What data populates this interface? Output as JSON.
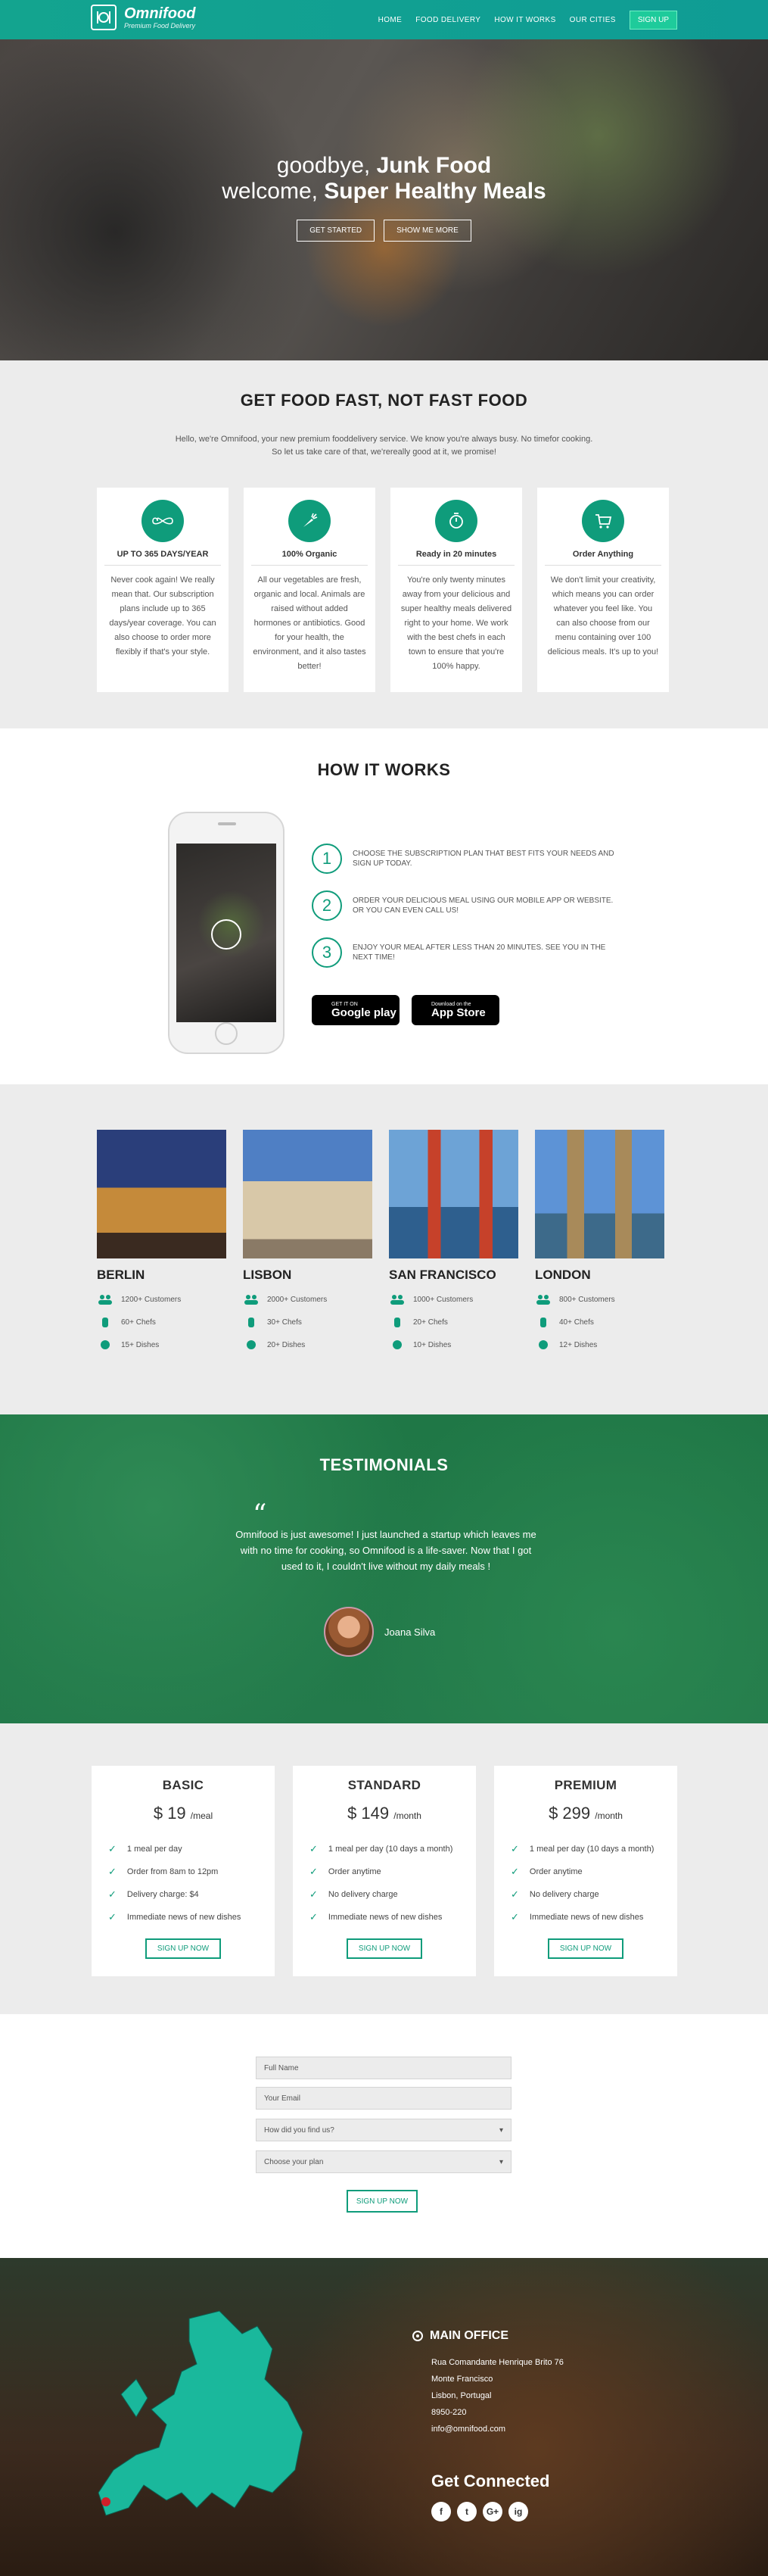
{
  "nav": {
    "brand": "Omnifood",
    "tagline": "Premium Food Delivery",
    "links": [
      "HOME",
      "FOOD DELIVERY",
      "HOW IT WORKS",
      "OUR CITIES"
    ],
    "cta": "SIGN UP"
  },
  "hero": {
    "line1_light": "goodbye, ",
    "line1_bold": "Junk Food",
    "line2_light": "welcome, ",
    "line2_bold": "Super Healthy Meals",
    "btn_primary": "GET STARTED",
    "btn_secondary": "SHOW ME MORE"
  },
  "features": {
    "title": "GET FOOD FAST, NOT FAST FOOD",
    "intro": "Hello, we're Omnifood, your new premium fooddelivery service. We know you're always busy. No timefor cooking. So let us take care of that, we'rereally good at it, we promise!",
    "cards": [
      {
        "icon": "infinity-icon",
        "title": "UP TO 365 DAYS/YEAR",
        "text": "Never cook again! We really mean that. Our subscription plans include up to 365 days/year coverage. You can also choose to order more flexibly if that's your style."
      },
      {
        "icon": "carrot-icon",
        "title": "100% Organic",
        "text": "All our vegetables are fresh, organic and local. Animals are raised without added hormones or antibiotics. Good for your health, the environment, and it also tastes better!"
      },
      {
        "icon": "stopwatch-icon",
        "title": "Ready in 20 minutes",
        "text": "You're only twenty minutes away from your delicious and super healthy meals delivered right to your home. We work with the best chefs in each town to ensure that you're 100% happy."
      },
      {
        "icon": "cart-icon",
        "title": "Order Anything",
        "text": "We don't limit your creativity, which means you can order whatever you feel like. You can also choose from our menu containing over 100 delicious meals. It's up to you!"
      }
    ]
  },
  "how": {
    "title": "HOW IT WORKS",
    "steps": [
      {
        "num": "1",
        "text": "CHOOSE THE SUBSCRIPTION PLAN THAT BEST FITS YOUR NEEDS AND SIGN UP TODAY."
      },
      {
        "num": "2",
        "text": "ORDER YOUR DELICIOUS MEAL USING OUR MOBILE APP OR WEBSITE. OR YOU CAN EVEN CALL US!"
      },
      {
        "num": "3",
        "text": "ENJOY YOUR MEAL AFTER LESS THAN 20 MINUTES. SEE YOU IN THE NEXT TIME!"
      }
    ],
    "google_small": "GET IT ON",
    "google_big": "Google play",
    "apple_small": "Download on the",
    "apple_big": "App Store"
  },
  "cities": [
    {
      "name": "BERLIN",
      "customers": "1200+ Customers",
      "chefs": "60+ Chefs",
      "dishes": "15+ Dishes"
    },
    {
      "name": "LISBON",
      "customers": "2000+ Customers",
      "chefs": "30+ Chefs",
      "dishes": "20+ Dishes"
    },
    {
      "name": "SAN FRANCISCO",
      "customers": "1000+ Customers",
      "chefs": "20+ Chefs",
      "dishes": "10+ Dishes"
    },
    {
      "name": "LONDON",
      "customers": "800+ Customers",
      "chefs": "40+ Chefs",
      "dishes": "12+ Dishes"
    }
  ],
  "testimonials": {
    "title": "TESTIMONIALS",
    "quote_mark": "“",
    "quote": "Omnifood is just awesome! I just launched a startup which leaves me with no time for cooking, so Omnifood is a life-saver. Now that I got used to it, I couldn't live without my daily meals !",
    "author": "Joana Silva"
  },
  "plans": [
    {
      "name": "BASIC",
      "price": "$ 19",
      "period": "/meal",
      "features": [
        "1 meal per day",
        "Order from 8am to 12pm",
        "Delivery charge: $4",
        "Immediate news of new dishes"
      ],
      "cta": "SIGN UP NOW"
    },
    {
      "name": "STANDARD",
      "price": "$ 149",
      "period": "/month",
      "features": [
        "1 meal per day (10 days a month)",
        "Order anytime",
        "No delivery charge",
        "Immediate news of new dishes"
      ],
      "cta": "SIGN UP NOW"
    },
    {
      "name": "PREMIUM",
      "price": "$ 299",
      "period": "/month",
      "features": [
        "1 meal per day (10 days a month)",
        "Order anytime",
        "No delivery charge",
        "Immediate news of new dishes"
      ],
      "cta": "SIGN UP NOW"
    }
  ],
  "form": {
    "full_name": "Full Name",
    "email": "Your Email",
    "how_found": "How did you find us?",
    "plan": "Choose your plan",
    "submit": "SIGN UP NOW"
  },
  "footer": {
    "office_title": "MAIN OFFICE",
    "address1": "Rua Comandante Henrique Brito 76",
    "address2": "Monte Francisco",
    "address3": "Lisbon, Portugal",
    "phone": "8950-220",
    "email": "info@omnifood.com",
    "connect": "Get Connected",
    "socials": [
      "f",
      "t",
      "G+",
      "ig"
    ]
  },
  "colors": {
    "accent": "#0f9c7b",
    "nav": "#13a48f",
    "testimonials": "#237a4b"
  }
}
